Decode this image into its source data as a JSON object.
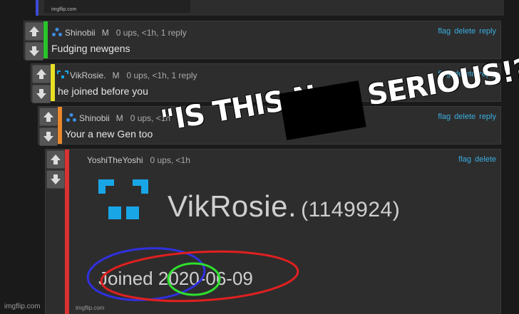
{
  "watermarks": {
    "top_thumb": "imgflip.com",
    "bottom_left": "imgflip.com",
    "embed": "imgflip.com"
  },
  "vote_icons": {
    "up": "arrow-up-icon",
    "down": "arrow-down-icon"
  },
  "comments": [
    {
      "user": "Shinobii",
      "badge": "M",
      "stats": "0 ups, <1h, 1 reply",
      "text": "Fudging newgens",
      "actions": [
        "flag",
        "delete",
        "reply"
      ],
      "bar_color": "#29c42a"
    },
    {
      "user": "VikRosie.",
      "badge": "M",
      "stats": "0 ups, <1h, 1 reply",
      "text": "he joined before you",
      "actions": [
        "flag",
        "delete",
        "reply"
      ],
      "bar_color": "#e8e024"
    },
    {
      "user": "Shinobii",
      "badge": "M",
      "stats": "0 ups, <1h",
      "text": "Your a new Gen too",
      "actions": [
        "flag",
        "delete",
        "reply"
      ],
      "bar_color": "#e8872c"
    },
    {
      "user": "YoshiTheYoshi",
      "badge": "",
      "stats": "0 ups, <1h",
      "text": "",
      "actions": [
        "flag",
        "delete"
      ],
      "bar_color": "#d93232"
    }
  ],
  "overlay": {
    "text": "\"IS THIS N",
    "text2": "SERIOUS!?\""
  },
  "embed_image": {
    "username": "VikRosie.",
    "user_id": "(1149924)",
    "joined_label": "Joined",
    "joined_year": "2020",
    "joined_rest": "-06-09"
  },
  "colors": {
    "link": "#3aaee0",
    "background": "#1a1a1a",
    "panel": "#2d2d2d",
    "circle_red": "#e02020",
    "circle_blue": "#3030e0",
    "circle_green": "#2ee02e",
    "id_icon": "#19a6e6"
  }
}
